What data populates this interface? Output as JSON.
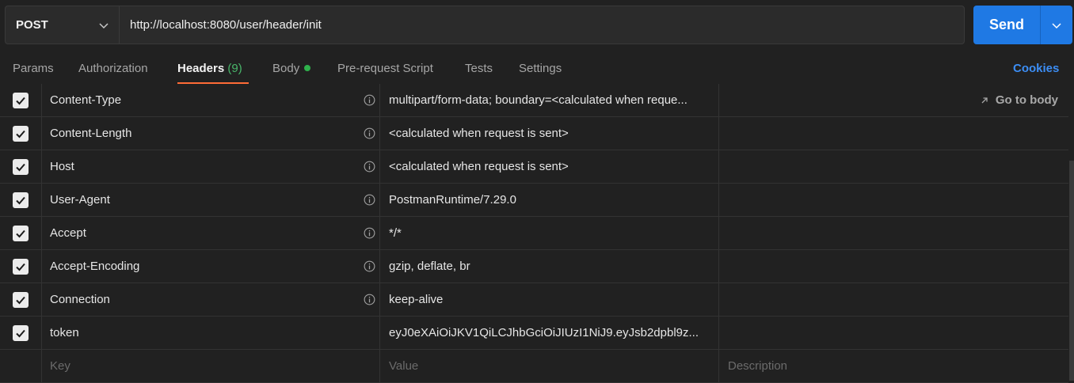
{
  "request": {
    "method": "POST",
    "url": "http://localhost:8080/user/header/init",
    "send_label": "Send"
  },
  "tabs": [
    {
      "label": "Params"
    },
    {
      "label": "Authorization"
    },
    {
      "label": "Headers",
      "count": "(9)"
    },
    {
      "label": "Body"
    },
    {
      "label": "Pre-request Script"
    },
    {
      "label": "Tests"
    },
    {
      "label": "Settings"
    }
  ],
  "cookies_label": "Cookies",
  "goto_body_label": "Go to body",
  "headers": [
    {
      "key": "Content-Type",
      "value": "multipart/form-data; boundary=<calculated when reque...",
      "checked": true
    },
    {
      "key": "Content-Length",
      "value": "<calculated when request is sent>",
      "checked": true
    },
    {
      "key": "Host",
      "value": "<calculated when request is sent>",
      "checked": true
    },
    {
      "key": "User-Agent",
      "value": "PostmanRuntime/7.29.0",
      "checked": true
    },
    {
      "key": "Accept",
      "value": "*/*",
      "checked": true
    },
    {
      "key": "Accept-Encoding",
      "value": "gzip, deflate, br",
      "checked": true
    },
    {
      "key": "Connection",
      "value": "keep-alive",
      "checked": true
    },
    {
      "key": "token",
      "value": "eyJ0eXAiOiJKV1QiLCJhbGciOiJIUzI1NiJ9.eyJsb2dpbl9z...",
      "checked": true
    }
  ],
  "new_row": {
    "key_placeholder": "Key",
    "value_placeholder": "Value",
    "description_placeholder": "Description"
  },
  "colors": {
    "send": "#1f79e4",
    "active_tab_underline": "#ff6c37",
    "cookies": "#3c8ef5",
    "count": "#49b66a"
  }
}
